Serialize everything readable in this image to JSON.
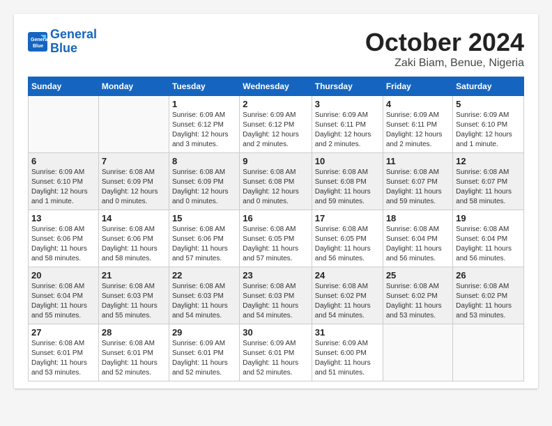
{
  "header": {
    "logo_line1": "General",
    "logo_line2": "Blue",
    "month_title": "October 2024",
    "location": "Zaki Biam, Benue, Nigeria"
  },
  "weekdays": [
    "Sunday",
    "Monday",
    "Tuesday",
    "Wednesday",
    "Thursday",
    "Friday",
    "Saturday"
  ],
  "weeks": [
    [
      {
        "day": "",
        "info": ""
      },
      {
        "day": "",
        "info": ""
      },
      {
        "day": "1",
        "info": "Sunrise: 6:09 AM\nSunset: 6:12 PM\nDaylight: 12 hours\nand 3 minutes."
      },
      {
        "day": "2",
        "info": "Sunrise: 6:09 AM\nSunset: 6:12 PM\nDaylight: 12 hours\nand 2 minutes."
      },
      {
        "day": "3",
        "info": "Sunrise: 6:09 AM\nSunset: 6:11 PM\nDaylight: 12 hours\nand 2 minutes."
      },
      {
        "day": "4",
        "info": "Sunrise: 6:09 AM\nSunset: 6:11 PM\nDaylight: 12 hours\nand 2 minutes."
      },
      {
        "day": "5",
        "info": "Sunrise: 6:09 AM\nSunset: 6:10 PM\nDaylight: 12 hours\nand 1 minute."
      }
    ],
    [
      {
        "day": "6",
        "info": "Sunrise: 6:09 AM\nSunset: 6:10 PM\nDaylight: 12 hours\nand 1 minute."
      },
      {
        "day": "7",
        "info": "Sunrise: 6:08 AM\nSunset: 6:09 PM\nDaylight: 12 hours\nand 0 minutes."
      },
      {
        "day": "8",
        "info": "Sunrise: 6:08 AM\nSunset: 6:09 PM\nDaylight: 12 hours\nand 0 minutes."
      },
      {
        "day": "9",
        "info": "Sunrise: 6:08 AM\nSunset: 6:08 PM\nDaylight: 12 hours\nand 0 minutes."
      },
      {
        "day": "10",
        "info": "Sunrise: 6:08 AM\nSunset: 6:08 PM\nDaylight: 11 hours\nand 59 minutes."
      },
      {
        "day": "11",
        "info": "Sunrise: 6:08 AM\nSunset: 6:07 PM\nDaylight: 11 hours\nand 59 minutes."
      },
      {
        "day": "12",
        "info": "Sunrise: 6:08 AM\nSunset: 6:07 PM\nDaylight: 11 hours\nand 58 minutes."
      }
    ],
    [
      {
        "day": "13",
        "info": "Sunrise: 6:08 AM\nSunset: 6:06 PM\nDaylight: 11 hours\nand 58 minutes."
      },
      {
        "day": "14",
        "info": "Sunrise: 6:08 AM\nSunset: 6:06 PM\nDaylight: 11 hours\nand 58 minutes."
      },
      {
        "day": "15",
        "info": "Sunrise: 6:08 AM\nSunset: 6:06 PM\nDaylight: 11 hours\nand 57 minutes."
      },
      {
        "day": "16",
        "info": "Sunrise: 6:08 AM\nSunset: 6:05 PM\nDaylight: 11 hours\nand 57 minutes."
      },
      {
        "day": "17",
        "info": "Sunrise: 6:08 AM\nSunset: 6:05 PM\nDaylight: 11 hours\nand 56 minutes."
      },
      {
        "day": "18",
        "info": "Sunrise: 6:08 AM\nSunset: 6:04 PM\nDaylight: 11 hours\nand 56 minutes."
      },
      {
        "day": "19",
        "info": "Sunrise: 6:08 AM\nSunset: 6:04 PM\nDaylight: 11 hours\nand 56 minutes."
      }
    ],
    [
      {
        "day": "20",
        "info": "Sunrise: 6:08 AM\nSunset: 6:04 PM\nDaylight: 11 hours\nand 55 minutes."
      },
      {
        "day": "21",
        "info": "Sunrise: 6:08 AM\nSunset: 6:03 PM\nDaylight: 11 hours\nand 55 minutes."
      },
      {
        "day": "22",
        "info": "Sunrise: 6:08 AM\nSunset: 6:03 PM\nDaylight: 11 hours\nand 54 minutes."
      },
      {
        "day": "23",
        "info": "Sunrise: 6:08 AM\nSunset: 6:03 PM\nDaylight: 11 hours\nand 54 minutes."
      },
      {
        "day": "24",
        "info": "Sunrise: 6:08 AM\nSunset: 6:02 PM\nDaylight: 11 hours\nand 54 minutes."
      },
      {
        "day": "25",
        "info": "Sunrise: 6:08 AM\nSunset: 6:02 PM\nDaylight: 11 hours\nand 53 minutes."
      },
      {
        "day": "26",
        "info": "Sunrise: 6:08 AM\nSunset: 6:02 PM\nDaylight: 11 hours\nand 53 minutes."
      }
    ],
    [
      {
        "day": "27",
        "info": "Sunrise: 6:08 AM\nSunset: 6:01 PM\nDaylight: 11 hours\nand 53 minutes."
      },
      {
        "day": "28",
        "info": "Sunrise: 6:08 AM\nSunset: 6:01 PM\nDaylight: 11 hours\nand 52 minutes."
      },
      {
        "day": "29",
        "info": "Sunrise: 6:09 AM\nSunset: 6:01 PM\nDaylight: 11 hours\nand 52 minutes."
      },
      {
        "day": "30",
        "info": "Sunrise: 6:09 AM\nSunset: 6:01 PM\nDaylight: 11 hours\nand 52 minutes."
      },
      {
        "day": "31",
        "info": "Sunrise: 6:09 AM\nSunset: 6:00 PM\nDaylight: 11 hours\nand 51 minutes."
      },
      {
        "day": "",
        "info": ""
      },
      {
        "day": "",
        "info": ""
      }
    ]
  ]
}
